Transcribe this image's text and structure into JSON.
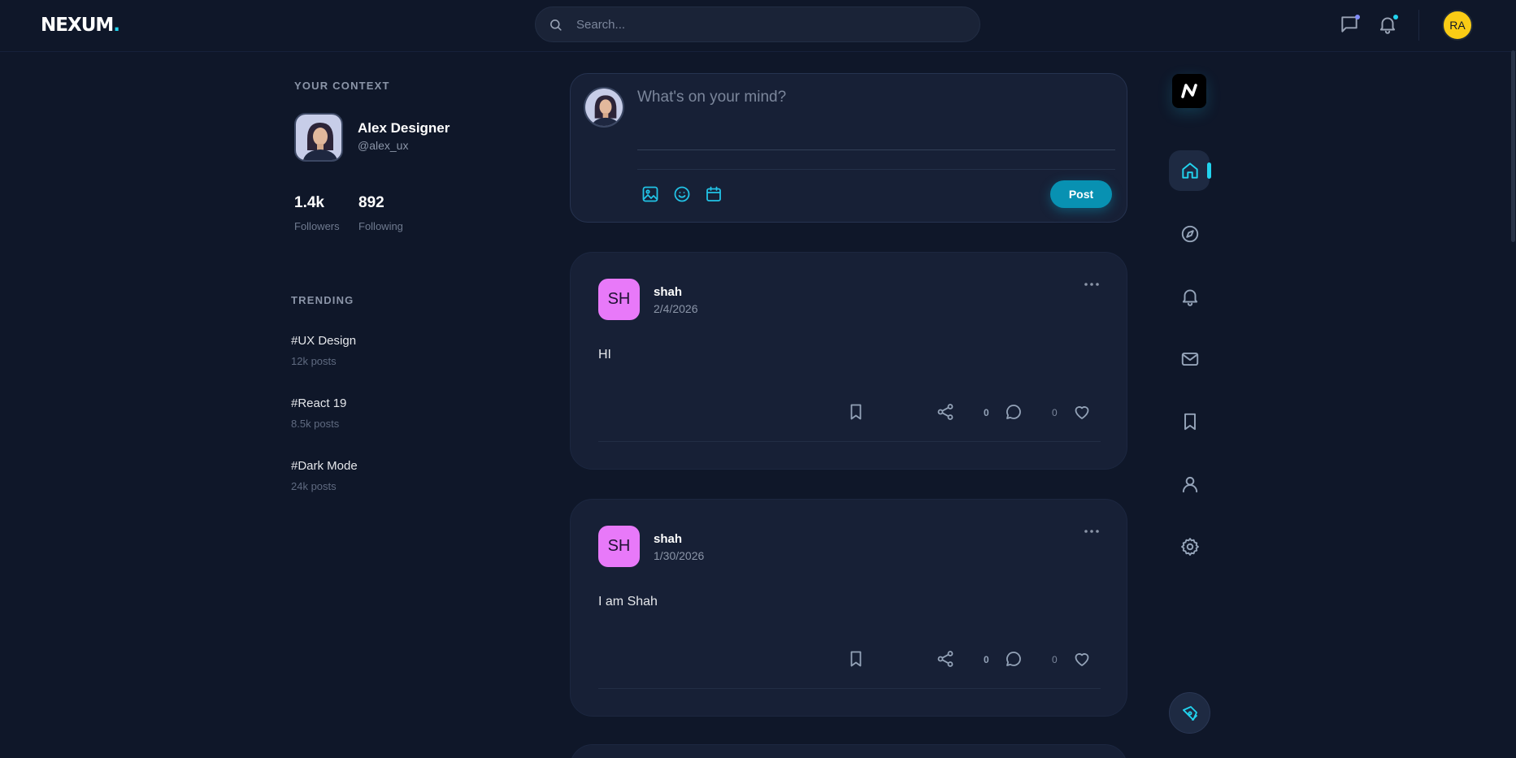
{
  "brand": {
    "name": "NEXUM",
    "dot": "."
  },
  "search": {
    "placeholder": "Search..."
  },
  "user": {
    "initials": "RA"
  },
  "context": {
    "title": "YOUR CONTEXT",
    "name": "Alex Designer",
    "handle": "@alex_ux",
    "stats": [
      {
        "value": "1.4k",
        "label": "Followers"
      },
      {
        "value": "892",
        "label": "Following"
      }
    ]
  },
  "trending": {
    "title": "TRENDING",
    "items": [
      {
        "tag": "#UX Design",
        "count": "12k posts"
      },
      {
        "tag": "#React 19",
        "count": "8.5k posts"
      },
      {
        "tag": "#Dark Mode",
        "count": "24k posts"
      }
    ]
  },
  "composer": {
    "placeholder": "What's on your mind?",
    "post_label": "Post"
  },
  "posts": [
    {
      "initials": "SH",
      "author": "shah",
      "date": "2/4/2026",
      "text": "HI",
      "shares": "0",
      "comments": "0"
    },
    {
      "initials": "SH",
      "author": "shah",
      "date": "1/30/2026",
      "text": "I am Shah",
      "shares": "0",
      "comments": "0"
    }
  ],
  "icons": {
    "search": "search-icon",
    "messages": "message-icon",
    "notifications": "bell-icon",
    "image": "image-icon",
    "emoji": "smile-icon",
    "calendar": "calendar-icon",
    "bookmark": "bookmark-icon",
    "share": "share-icon",
    "comment": "comment-icon",
    "like": "heart-icon",
    "more": "more-icon",
    "home": "home-icon",
    "explore": "compass-icon",
    "mail": "mail-icon",
    "profile": "user-icon",
    "settings": "gear-icon",
    "compose": "pen-icon"
  },
  "colors": {
    "accent": "#22d3ee",
    "post_button": "#0891b2",
    "author_avatar": "#e879f9",
    "user_avatar": "#facc15"
  }
}
